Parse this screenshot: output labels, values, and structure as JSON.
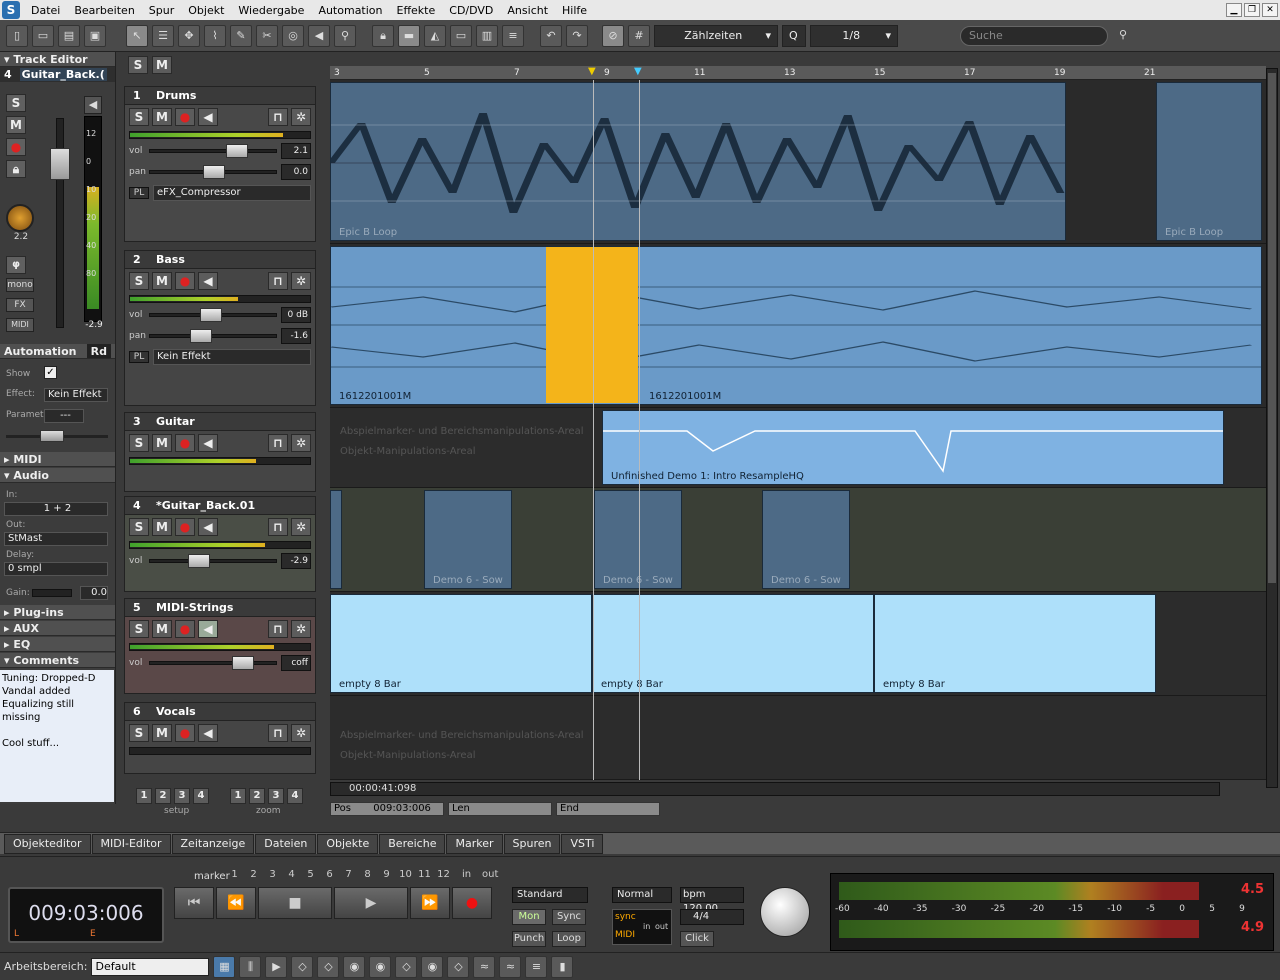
{
  "menu": {
    "items": [
      "Datei",
      "Bearbeiten",
      "Spur",
      "Objekt",
      "Wiedergabe",
      "Automation",
      "Effekte",
      "CD/DVD",
      "Ansicht",
      "Hilfe"
    ]
  },
  "toolbar": {
    "grid_label": "Zählzeiten",
    "quantize_label": "Q",
    "quantize_value": "1/8",
    "search_placeholder": "Suche"
  },
  "left": {
    "track_editor": "Track Editor",
    "track_num": "4",
    "track_name": "Guitar_Back.(",
    "meter_scale": [
      "12",
      "0",
      "10",
      "20",
      "40",
      "80"
    ],
    "meter_value": "-2.9",
    "pan_value": "2.2",
    "mono": "mono",
    "fx": "FX",
    "midi": "MIDI",
    "automation": "Automation",
    "automation_mode": "Rd",
    "show": "Show",
    "effect_label": "Effect:",
    "effect_value": "Kein Effekt",
    "parameter_label": "Parameter",
    "parameter_value": "---",
    "midi_section": "MIDI",
    "audio_section": "Audio",
    "in_label": "In:",
    "in_value": "1 + 2",
    "out_label": "Out:",
    "out_value": "StMast",
    "delay_label": "Delay:",
    "delay_value": "0 smpl",
    "gain_label": "Gain:",
    "gain_value": "0.0",
    "plugins": "Plug-ins",
    "aux": "AUX",
    "eq": "EQ",
    "comments": "Comments",
    "comment_text": [
      "Tuning: Dropped-D",
      "Vandal added",
      "Equalizing still missing",
      "",
      "Cool stuff..."
    ]
  },
  "tracks": [
    {
      "num": "1",
      "name": "Drums",
      "meter": 0.85,
      "vol": "2.1",
      "pan": "0.0",
      "plugin": "eFX_Compressor"
    },
    {
      "num": "2",
      "name": "Bass",
      "meter": 0.6,
      "vol": "0 dB",
      "pan": "-1.6",
      "plugin": "Kein Effekt"
    },
    {
      "num": "3",
      "name": "Guitar",
      "meter": 0.7
    },
    {
      "num": "4",
      "name": "*Guitar_Back.01",
      "meter": 0.75,
      "vol": "-2.9"
    },
    {
      "num": "5",
      "name": "MIDI-Strings",
      "meter": 0.8,
      "vol": "coff"
    },
    {
      "num": "6",
      "name": "Vocals",
      "meter": 0.0
    }
  ],
  "ruler_ticks": [
    "3",
    "5",
    "7",
    "9",
    "11",
    "13",
    "15",
    "17",
    "19",
    "21"
  ],
  "clips": {
    "drums_name": "Epic B   Loop",
    "bass_name": "1612201001M",
    "guitar_name": "Unfinished Demo 1: Intro   ResampleHQ",
    "gback_name": "Demo 6 - Sow",
    "strings_name": "empty 8 Bar",
    "area_hint_1": "Abspielmarker- und Bereichsmanipulations-Areal",
    "area_hint_2": "Objekt-Manipulations-Areal"
  },
  "footer_panel": {
    "setup": "setup",
    "zoom": "zoom",
    "setup_nums": [
      "1",
      "2",
      "3",
      "4"
    ],
    "zoom_nums": [
      "1",
      "2",
      "3",
      "4"
    ]
  },
  "timeline": {
    "timecode": "00:00:41:098",
    "pos_label": "Pos",
    "pos_value": "009:03:006",
    "len_label": "Len",
    "end_label": "End"
  },
  "bottom_tabs": [
    "Objekteditor",
    "MIDI-Editor",
    "Zeitanzeige",
    "Dateien",
    "Objekte",
    "Bereiche",
    "Marker",
    "Spuren",
    "VSTi"
  ],
  "transport": {
    "marker": "marker",
    "marker_nums": [
      "1",
      "2",
      "3",
      "4",
      "5",
      "6",
      "7",
      "8",
      "9",
      "10",
      "11",
      "12"
    ],
    "in": "in",
    "out": "out",
    "time": "009:03:006",
    "l": "L",
    "e": "E",
    "mode": "Standard",
    "mon": "Mon",
    "sync": "Sync",
    "punch": "Punch",
    "loop": "Loop",
    "normal": "Normal",
    "bpm": "bpm 120.00",
    "sig": "4/4",
    "click": "Click",
    "sync_midi": "sync",
    "midi": "MIDI",
    "in_small": "in",
    "out_small": "out",
    "meter_scale": [
      "-60",
      "-40",
      "-35",
      "-30",
      "-25",
      "-20",
      "-15",
      "-10",
      "-5",
      "0",
      "5",
      "9"
    ],
    "peak_l": "4.5",
    "peak_r": "4.9"
  },
  "status": {
    "workspace_label": "Arbeitsbereich:",
    "workspace_value": "Default"
  }
}
